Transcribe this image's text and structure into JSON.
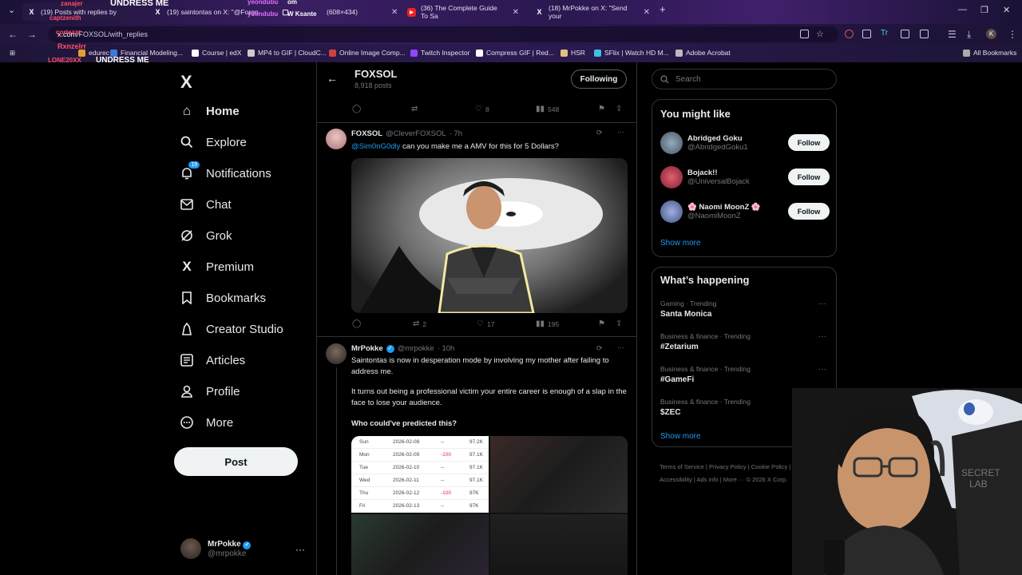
{
  "browser": {
    "tabs": [
      {
        "label": "(19) Posts with replies by",
        "icon": "x-logo-icon"
      },
      {
        "label": "(19) saintontas on X: \"@Forgo",
        "icon": "x-logo-icon"
      },
      {
        "label": "(608×434)",
        "icon": "image-icon"
      },
      {
        "label": "(36) The Complete Guide To Sa",
        "icon": "youtube-icon"
      },
      {
        "label": "(18) MrPokke on X: \"Send your",
        "icon": "x-logo-icon"
      }
    ],
    "new_tab": "+",
    "address": {
      "host": "x.com",
      "path": "/FOXSOL/with_replies"
    },
    "bookmarks": [
      {
        "label": "edurec",
        "color": "#e0a030"
      },
      {
        "label": "Financial Modeling...",
        "color": "#3a7bd5"
      },
      {
        "label": "Course | edX",
        "color": "#ffffff"
      },
      {
        "label": "MP4 to GIF | CloudC...",
        "color": "#cccccc"
      },
      {
        "label": "Online Image Comp...",
        "color": "#d04040"
      },
      {
        "label": "Twitch Inspector",
        "color": "#9146ff"
      },
      {
        "label": "Compress GIF | Red...",
        "color": "#ffffff"
      },
      {
        "label": "HSR",
        "color": "#e0c080"
      },
      {
        "label": "SFlix | Watch HD M...",
        "color": "#40c0e0"
      },
      {
        "label": "Adobe Acrobat",
        "color": "#bbbbbb"
      }
    ],
    "all_bookmarks": "All Bookmarks"
  },
  "overlay": {
    "chat": [
      {
        "text": "UNDRESS ME",
        "color": "#ffffff"
      },
      {
        "text": "zanajer",
        "color": "#ff4d6d"
      },
      {
        "text": "yeondubu",
        "color": "#e070ff"
      },
      {
        "text": "om",
        "color": "#ffffff"
      },
      {
        "text": "yeondubu",
        "color": "#e070ff"
      },
      {
        "text": "W Ksante",
        "color": "#ffffff"
      },
      {
        "text": "captzenith",
        "color": "#ff4d6d"
      },
      {
        "text": "cortezzz",
        "color": "#ff4d6d"
      },
      {
        "text": "Rxnzelrr",
        "color": "#ff4d6d"
      },
      {
        "text": "LONE20XX",
        "color": "#ff4d6d"
      },
      {
        "text": "UNDRESS ME",
        "color": "#ffffff"
      }
    ]
  },
  "sidebar": {
    "logo": "X",
    "items": [
      {
        "label": "Home",
        "icon": "⌂"
      },
      {
        "label": "Explore",
        "icon": "⚲"
      },
      {
        "label": "Notifications",
        "icon": "🔔",
        "badge": "19"
      },
      {
        "label": "Chat",
        "icon": "✉"
      },
      {
        "label": "Grok",
        "icon": "◌"
      },
      {
        "label": "Premium",
        "icon": "X"
      },
      {
        "label": "Bookmarks",
        "icon": "⚑"
      },
      {
        "label": "Creator Studio",
        "icon": "♙"
      },
      {
        "label": "Articles",
        "icon": "☰"
      },
      {
        "label": "Profile",
        "icon": "♟"
      },
      {
        "label": "More",
        "icon": "⋯"
      }
    ],
    "post_label": "Post",
    "account": {
      "name": "MrPokke",
      "handle": "@mrpokke"
    }
  },
  "header": {
    "title": "FOXSOL",
    "subtitle": "8,918 posts",
    "follow_state": "Following"
  },
  "top_actions": {
    "replies": "",
    "reposts": "",
    "likes": "8",
    "views": "548"
  },
  "tweets": [
    {
      "name": "FOXSOL",
      "handle": "@CleverFOXSOL",
      "time": "· 7h",
      "mention": "@Sim0nG0dly",
      "text": "can you make me a AMV for this for 5 Dollars?",
      "replies": "",
      "reposts": "2",
      "likes": "17",
      "views": "195"
    },
    {
      "name": "MrPokke",
      "handle": "@mrpokke",
      "time": "· 10h",
      "p1": "Saintontas is now in desperation mode by involving my mother after failing to address me.",
      "p2": "It turns out being a professional victim your entire career is enough of a slap in the face to lose your audience.",
      "p3": "Who could've predicted this?"
    }
  ],
  "table_rows": [
    {
      "day": "Sun",
      "date": "2026-02-08",
      "delta": "--",
      "value": "97.2K"
    },
    {
      "day": "Mon",
      "date": "2026-02-09",
      "delta": "-100",
      "value": "97.1K"
    },
    {
      "day": "Tue",
      "date": "2026-02-10",
      "delta": "--",
      "value": "97.1K"
    },
    {
      "day": "Wed",
      "date": "2026-02-11",
      "delta": "--",
      "value": "97.1K"
    },
    {
      "day": "Thu",
      "date": "2026-02-12",
      "delta": "-100",
      "value": "97K"
    },
    {
      "day": "Fri",
      "date": "2026-02-13",
      "delta": "--",
      "value": "97K"
    }
  ],
  "right": {
    "search_placeholder": "Search",
    "you_might_like": {
      "title": "You might like",
      "items": [
        {
          "name": "Abridged Goku",
          "handle": "@AbridgedGoku1",
          "avatar": "#6a7f8c"
        },
        {
          "name": "Bojack!!",
          "handle": "@UniversalBojack",
          "avatar": "#c0304a"
        },
        {
          "name": "🌸 Naomi MoonZ 🌸",
          "handle": "@NaomiMoonZ",
          "avatar": "#6b7ab0"
        }
      ],
      "follow_label": "Follow",
      "show_more": "Show more"
    },
    "whats_happening": {
      "title": "What’s happening",
      "trends": [
        {
          "meta": "Gaming · Trending",
          "name": "Santa Monica"
        },
        {
          "meta": "Business & finance · Trending",
          "name": "#Zetarium"
        },
        {
          "meta": "Business & finance · Trending",
          "name": "#GameFi"
        },
        {
          "meta": "Business & finance · Trending",
          "name": "$ZEC"
        }
      ],
      "show_more": "Show more"
    },
    "footer_line1": "Terms of Service  |  Privacy Policy  |  Cookie Policy  |",
    "footer_line2": "Accessibility  |  Ads info  |  More ···  © 2026 X Corp."
  }
}
